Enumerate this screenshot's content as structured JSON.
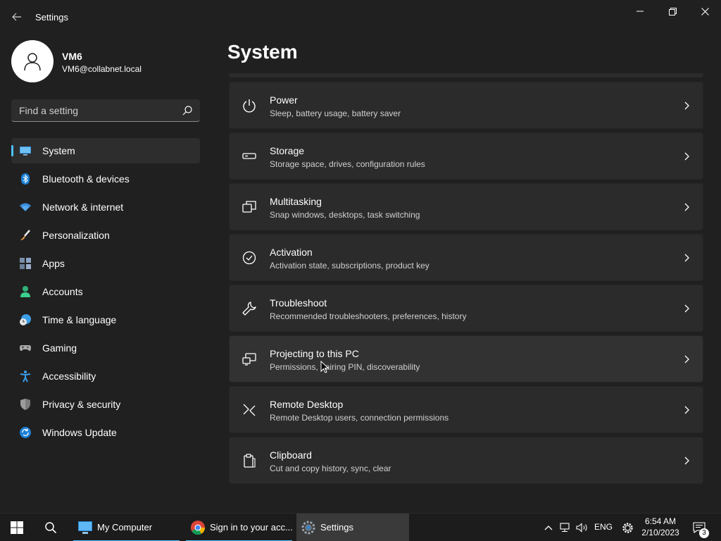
{
  "window": {
    "title": "Settings"
  },
  "profile": {
    "name": "VM6",
    "email": "VM6@collabnet.local"
  },
  "search": {
    "placeholder": "Find a setting"
  },
  "sidebar": {
    "items": [
      {
        "label": "System",
        "icon": "monitor-icon",
        "selected": true
      },
      {
        "label": "Bluetooth & devices",
        "icon": "bluetooth-icon"
      },
      {
        "label": "Network & internet",
        "icon": "wifi-icon"
      },
      {
        "label": "Personalization",
        "icon": "brush-icon"
      },
      {
        "label": "Apps",
        "icon": "apps-icon"
      },
      {
        "label": "Accounts",
        "icon": "person-icon"
      },
      {
        "label": "Time & language",
        "icon": "clock-globe-icon"
      },
      {
        "label": "Gaming",
        "icon": "gamepad-icon"
      },
      {
        "label": "Accessibility",
        "icon": "accessibility-icon"
      },
      {
        "label": "Privacy & security",
        "icon": "shield-icon"
      },
      {
        "label": "Windows Update",
        "icon": "update-icon"
      }
    ]
  },
  "page": {
    "title": "System"
  },
  "cards": [
    {
      "title": "Power",
      "subtitle": "Sleep, battery usage, battery saver",
      "icon": "power-icon"
    },
    {
      "title": "Storage",
      "subtitle": "Storage space, drives, configuration rules",
      "icon": "storage-icon"
    },
    {
      "title": "Multitasking",
      "subtitle": "Snap windows, desktops, task switching",
      "icon": "multitasking-icon"
    },
    {
      "title": "Activation",
      "subtitle": "Activation state, subscriptions, product key",
      "icon": "check-circle-icon"
    },
    {
      "title": "Troubleshoot",
      "subtitle": "Recommended troubleshooters, preferences, history",
      "icon": "wrench-icon"
    },
    {
      "title": "Projecting to this PC",
      "subtitle": "Permissions, pairing PIN, discoverability",
      "icon": "projecting-icon"
    },
    {
      "title": "Remote Desktop",
      "subtitle": "Remote Desktop users, connection permissions",
      "icon": "remote-desktop-icon"
    },
    {
      "title": "Clipboard",
      "subtitle": "Cut and copy history, sync, clear",
      "icon": "clipboard-icon"
    }
  ],
  "taskbar": {
    "apps": [
      {
        "label": "My Computer",
        "icon": "my-computer-icon"
      },
      {
        "label": "Sign in to your acc...",
        "icon": "chrome-icon"
      },
      {
        "label": "Settings",
        "icon": "settings-gear-icon"
      }
    ],
    "language": "ENG",
    "time": "6:54 AM",
    "date": "2/10/2023",
    "notification_count": "3"
  },
  "colors": {
    "background": "#202020",
    "card": "#2b2b2b",
    "accent": "#4cc2ff",
    "taskbar": "#1c1c1c"
  }
}
